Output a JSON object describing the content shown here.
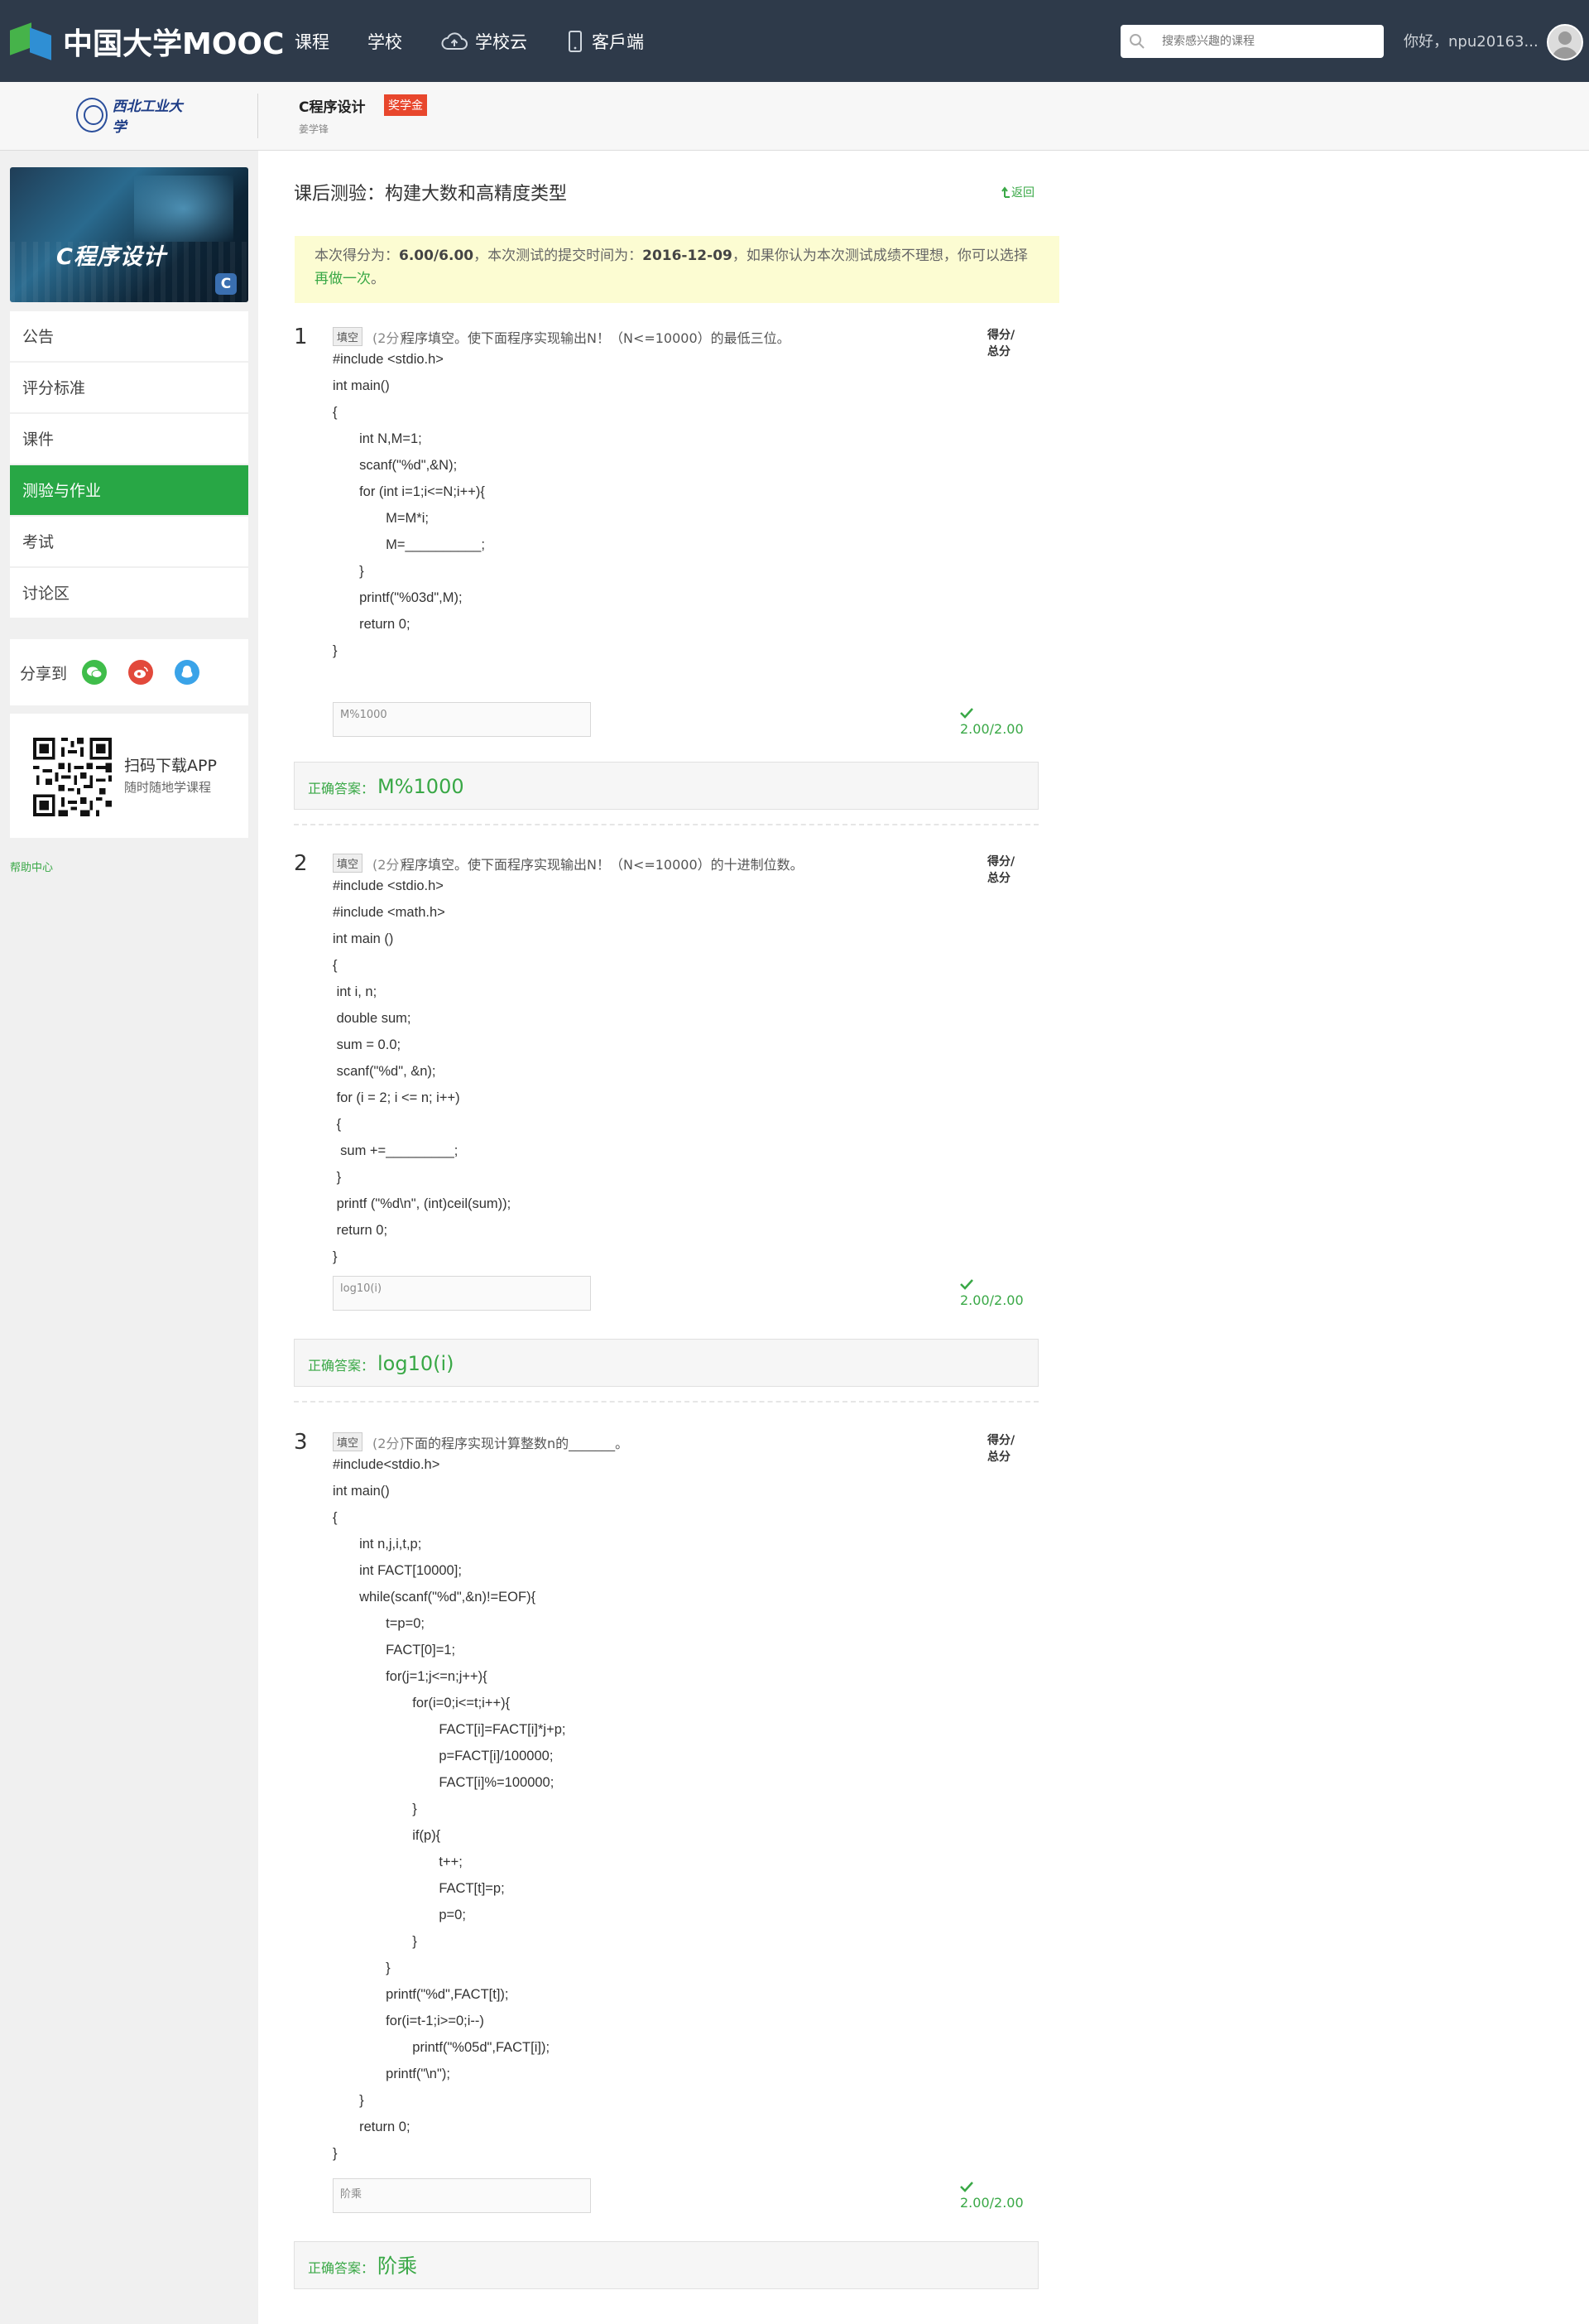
{
  "header": {
    "logo_text": "中国大学MOOC",
    "nav": [
      "课程",
      "学校",
      "学校云",
      "客戶端"
    ],
    "search_placeholder": "搜索感兴趣的课程",
    "greeting": "你好，npu20163..."
  },
  "course": {
    "school_name": "西北工业大学",
    "title": "C程序设计",
    "badge": "奖学金",
    "teacher": "姜学锋"
  },
  "sidebar": {
    "banner_text": "C程序设计",
    "banner_icon": "C",
    "menu": [
      "公告",
      "评分标准",
      "课件",
      "测验与作业",
      "考试",
      "讨论区"
    ],
    "active_index": 3,
    "share_label": "分享到",
    "share_icons": [
      "wechat-icon",
      "weibo-icon",
      "qq-icon"
    ],
    "app_title": "扫码下载APP",
    "app_subtitle": "随时随地学课程",
    "help": "帮助中心"
  },
  "main": {
    "title": "课后测验：构建大数和高精度类型",
    "back": "返回",
    "notice": {
      "prefix": "本次得分为：",
      "score": "6.00/6.00",
      "middle": "，本次测试的提交时间为：",
      "date": "2016-12-09",
      "suffix": "，如果你认为本次测试成绩不理想，你可以选择",
      "link": "再做一次",
      "end": "。"
    },
    "total_label": "得分/总分",
    "correct_label": "正确答案：",
    "questions": [
      {
        "num": "1",
        "type": "填空",
        "score": "(2分)",
        "stem": "程序填空。使下面程序实现输出N！（N<=10000）的最低三位。",
        "code": "#include <stdio.h>\nint main()\n{\n       int N,M=1;\n       scanf(\"%d\",&N);\n       for (int i=1;i<=N;i++){\n              M=M*i;\n              M=__________;\n       }\n       printf(\"%03d\",M);\n       return 0;\n}",
        "answer": "M%1000",
        "got": "2.00/2.00",
        "correct": "M%1000"
      },
      {
        "num": "2",
        "type": "填空",
        "score": "(2分)",
        "stem": "程序填空。使下面程序实现输出N！（N<=10000）的十进制位数。",
        "code": "#include <stdio.h>\n#include <math.h>\nint main ()\n{\n int i, n;\n double sum;\n sum = 0.0;\n scanf(\"%d\", &n);\n for (i = 2; i <= n; i++)\n {\n  sum +=_________;\n }\n printf (\"%d\\n\", (int)ceil(sum));\n return 0;\n}",
        "answer": "log10(i)",
        "got": "2.00/2.00",
        "correct": "log10(i)"
      },
      {
        "num": "3",
        "type": "填空",
        "score": "(2分)",
        "stem": "下面的程序实现计算整数n的_______。",
        "code": "#include<stdio.h>\nint main()\n{\n       int n,j,i,t,p;\n       int FACT[10000];\n       while(scanf(\"%d\",&n)!=EOF){\n              t=p=0;\n              FACT[0]=1;\n              for(j=1;j<=n;j++){\n                     for(i=0;i<=t;i++){\n                            FACT[i]=FACT[i]*j+p;\n                            p=FACT[i]/100000;\n                            FACT[i]%=100000;\n                     }\n                     if(p){\n                            t++;\n                            FACT[t]=p;\n                            p=0;\n                     }\n              }\n              printf(\"%d\",FACT[t]);\n              for(i=t-1;i>=0;i--)\n                     printf(\"%05d\",FACT[i]);\n              printf(\"\\n\");\n       }\n       return 0;\n}",
        "answer": "阶乘",
        "got": "2.00/2.00",
        "correct": "阶乘"
      }
    ]
  }
}
